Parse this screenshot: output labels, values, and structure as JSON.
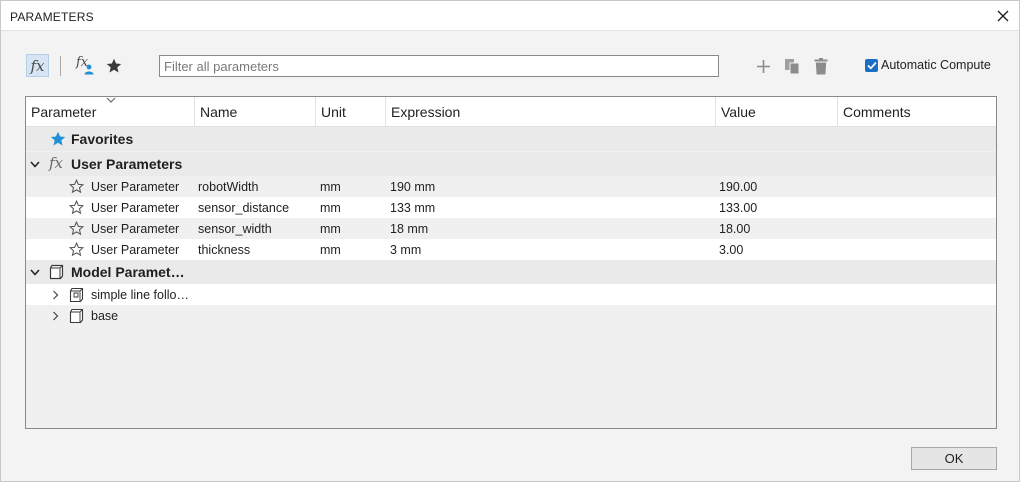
{
  "window": {
    "title": "PARAMETERS"
  },
  "toolbar": {
    "fx_label": "fx",
    "fx_user_label": "fx",
    "filter_placeholder": "Filter all parameters",
    "auto_compute_label": "Automatic Compute",
    "auto_compute_checked": true
  },
  "columns": [
    "Parameter",
    "Name",
    "Unit",
    "Expression",
    "Value",
    "Comments"
  ],
  "groups": {
    "favorites": {
      "label": "Favorites"
    },
    "user": {
      "label": "User Parameters",
      "icon": "fx"
    },
    "model": {
      "label": "Model Paramet…"
    }
  },
  "user_params": [
    {
      "type": "User Parameter",
      "name": "robotWidth",
      "unit": "mm",
      "expression": "190 mm",
      "value": "190.00",
      "comments": ""
    },
    {
      "type": "User Parameter",
      "name": "sensor_distance",
      "unit": "mm",
      "expression": "133 mm",
      "value": "133.00",
      "comments": ""
    },
    {
      "type": "User Parameter",
      "name": "sensor_width",
      "unit": "mm",
      "expression": "18 mm",
      "value": "18.00",
      "comments": ""
    },
    {
      "type": "User Parameter",
      "name": "thickness",
      "unit": "mm",
      "expression": "3 mm",
      "value": "3.00",
      "comments": ""
    }
  ],
  "model_items": [
    {
      "label": "simple line follo…"
    },
    {
      "label": "base"
    }
  ],
  "footer": {
    "ok_label": "OK"
  },
  "colors": {
    "accent": "#1a6fc4",
    "star_favorite": "#1f8fd6"
  }
}
